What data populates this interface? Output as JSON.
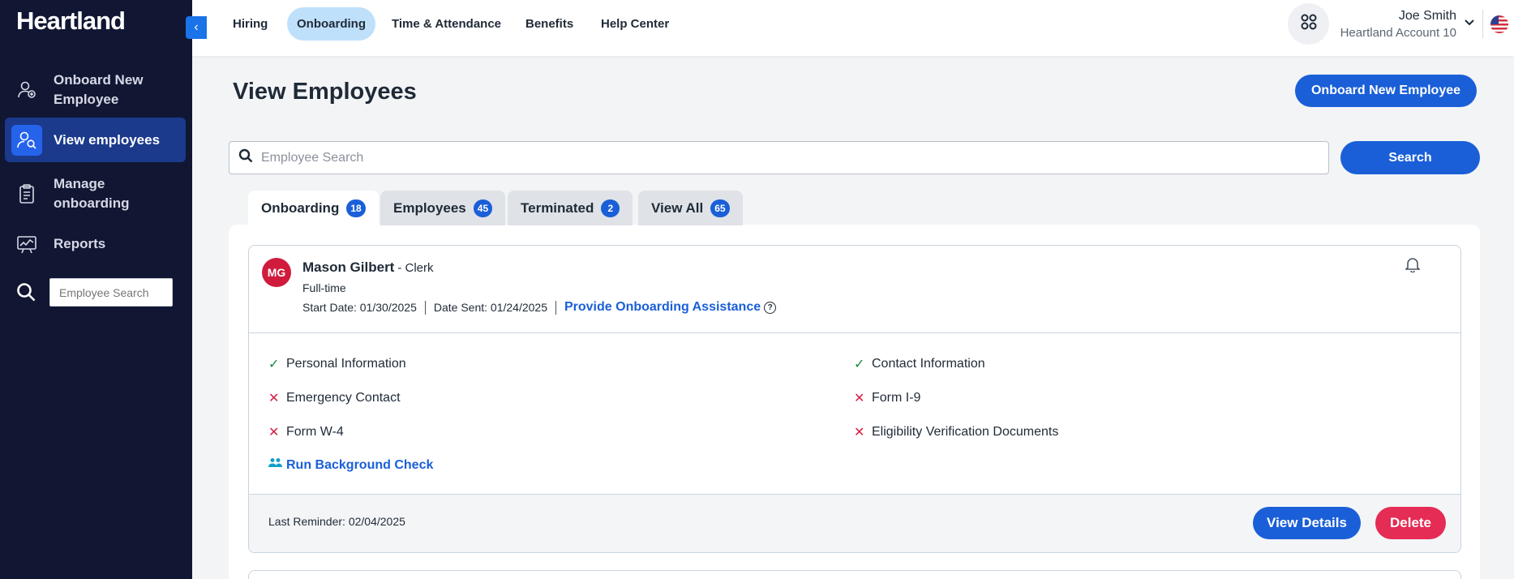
{
  "sidebar": {
    "brand": "Heartland",
    "items": [
      {
        "label": "Onboard New Employee"
      },
      {
        "label": "View employees"
      },
      {
        "label": "Manage onboarding"
      },
      {
        "label": "Reports"
      }
    ],
    "search_placeholder": "Employee Search"
  },
  "topnav": {
    "items": [
      "Hiring",
      "Onboarding",
      "Time & Attendance",
      "Benefits",
      "Help Center"
    ],
    "active": "Onboarding"
  },
  "user": {
    "name": "Joe Smith",
    "account": "Heartland Account 10"
  },
  "page": {
    "title": "View Employees",
    "onboard_button": "Onboard New Employee",
    "search_placeholder": "Employee Search",
    "search_button": "Search"
  },
  "tabs": [
    {
      "label": "Onboarding",
      "count": "18"
    },
    {
      "label": "Employees",
      "count": "45"
    },
    {
      "label": "Terminated",
      "count": "2"
    },
    {
      "label": "View All",
      "count": "65"
    }
  ],
  "employee": {
    "initials": "MG",
    "name": "Mason Gilbert",
    "role": "- Clerk",
    "type": "Full-time",
    "start_date": "Start Date: 01/30/2025",
    "date_sent": "Date Sent: 01/24/2025",
    "assist_link": "Provide Onboarding Assistance",
    "tasks": [
      {
        "label": "Personal Information",
        "status": "complete"
      },
      {
        "label": "Contact Information",
        "status": "complete"
      },
      {
        "label": "Emergency Contact",
        "status": "incomplete"
      },
      {
        "label": "Form I-9",
        "status": "incomplete"
      },
      {
        "label": "Form W-4",
        "status": "incomplete"
      },
      {
        "label": "Eligibility Verification Documents",
        "status": "incomplete"
      }
    ],
    "background_check": "Run Background Check",
    "last_reminder": "Last Reminder: 02/04/2025",
    "view_details": "View Details",
    "delete": "Delete"
  },
  "colors": {
    "sidebar_bg": "#111633",
    "primary": "#1a5fd8",
    "danger": "#e42c55",
    "success": "#148a3a",
    "avatar": "#d01b3c"
  }
}
